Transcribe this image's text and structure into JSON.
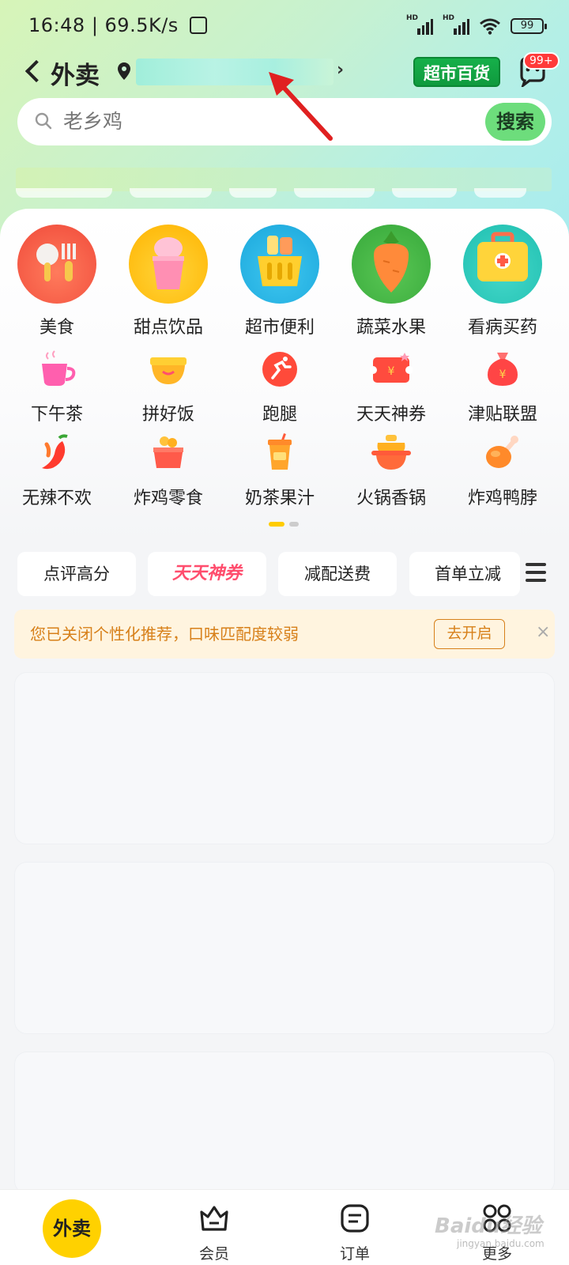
{
  "status_bar": {
    "time": "16:48",
    "speed": "69.5K/s",
    "battery": "99",
    "network": "HD"
  },
  "header": {
    "title": "外卖",
    "supermarket_label": "超市百货",
    "message_badge": "99+"
  },
  "search": {
    "placeholder": "老乡鸡",
    "button_label": "搜索"
  },
  "categories_main": [
    {
      "label": "美食",
      "icon": "food-icon"
    },
    {
      "label": "甜点饮品",
      "icon": "dessert-icon"
    },
    {
      "label": "超市便利",
      "icon": "basket-icon"
    },
    {
      "label": "蔬菜水果",
      "icon": "vegetable-icon"
    },
    {
      "label": "看病买药",
      "icon": "medkit-icon"
    }
  ],
  "categories_row2": [
    {
      "label": "下午茶",
      "icon": "tea-cup-icon"
    },
    {
      "label": "拼好饭",
      "icon": "bowl-icon"
    },
    {
      "label": "跑腿",
      "icon": "runner-icon"
    },
    {
      "label": "天天神券",
      "icon": "coupon-icon"
    },
    {
      "label": "津贴联盟",
      "icon": "money-bag-icon"
    }
  ],
  "categories_row3": [
    {
      "label": "无辣不欢",
      "icon": "chili-icon"
    },
    {
      "label": "炸鸡零食",
      "icon": "fried-chicken-basket-icon"
    },
    {
      "label": "奶茶果汁",
      "icon": "milk-tea-icon"
    },
    {
      "label": "火锅香锅",
      "icon": "hotpot-icon"
    },
    {
      "label": "炸鸡鸭脖",
      "icon": "drumstick-icon"
    }
  ],
  "filters": [
    {
      "label": "点评高分"
    },
    {
      "label": "天天神券"
    },
    {
      "label": "减配送费"
    },
    {
      "label": "首单立减"
    }
  ],
  "notice": {
    "text": "您已关闭个性化推荐，口味匹配度较弱",
    "button_label": "去开启",
    "close": "×"
  },
  "bottom_nav": {
    "home": "外卖",
    "items": [
      {
        "label": "会员",
        "icon": "crown-icon"
      },
      {
        "label": "订单",
        "icon": "order-icon"
      },
      {
        "label": "更多",
        "icon": "grid-icon"
      }
    ]
  },
  "watermark": {
    "main": "Baidu经验",
    "sub": "jingyan.baidu.com"
  },
  "colors": {
    "accent_green": "#16b04a",
    "search_button": "#6ddd7c",
    "brand_yellow": "#ffd100",
    "notice_orange": "#d7801a",
    "arrow_red": "#e02020"
  }
}
